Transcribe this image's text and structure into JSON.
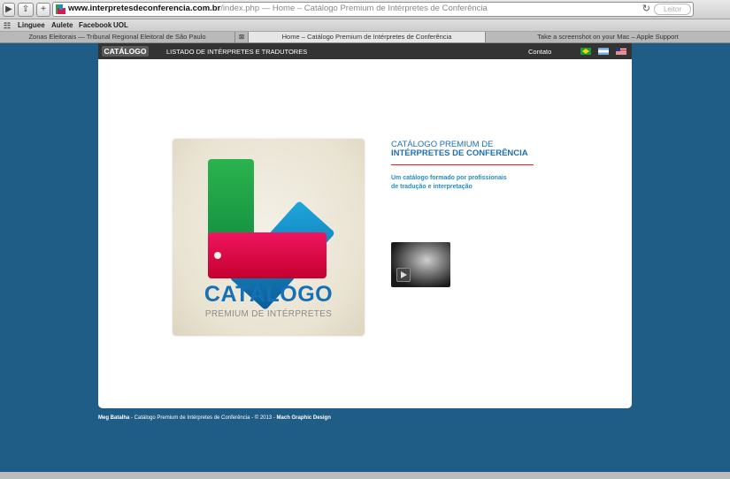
{
  "browser": {
    "url_host": "www.interpretesdeconferencia.com.br",
    "url_rest": "/index.php — Home – Catálogo Premium de Intérpretes de Conferência",
    "reader_label": "Leitor",
    "bookmarks": [
      "Linguee",
      "Aulete",
      "Facebook",
      "UOL"
    ],
    "tabs": [
      "Zonas Eleitorais — Tribunal Regional Eleitoral de São Paulo",
      "Home – Catálogo Premium de Intérpretes de Conferência",
      "Take a screenshot on your Mac – Apple Support"
    ]
  },
  "nav": {
    "logo": "CATÁLOGO",
    "directory_link": "LISTADO DE INTÉRPRETES E TRADUTORES",
    "contact_link": "Contato"
  },
  "logo_card": {
    "title": "CATÁLOGO",
    "subtitle": "PREMIUM DE INTÉRPRETES"
  },
  "headline": {
    "line1": "CATÁLOGO PREMIUM DE",
    "line2": "INTÉRPRETES DE CONFERÊNCIA"
  },
  "tagline": {
    "line1": "Um catálogo formado por profissionais",
    "line2": "de tradução e interpretação"
  },
  "footer": {
    "author": "Meg Batalha",
    "text": " - Catálogo Premium de Intérpretes de Conferência - © 2013 - ",
    "designer": "Mach Graphic Design"
  },
  "colors": {
    "page_bg": "#1f5d86",
    "nav_bg": "#333333",
    "accent_blue": "#1d6fb5",
    "accent_red": "#dd2222"
  }
}
